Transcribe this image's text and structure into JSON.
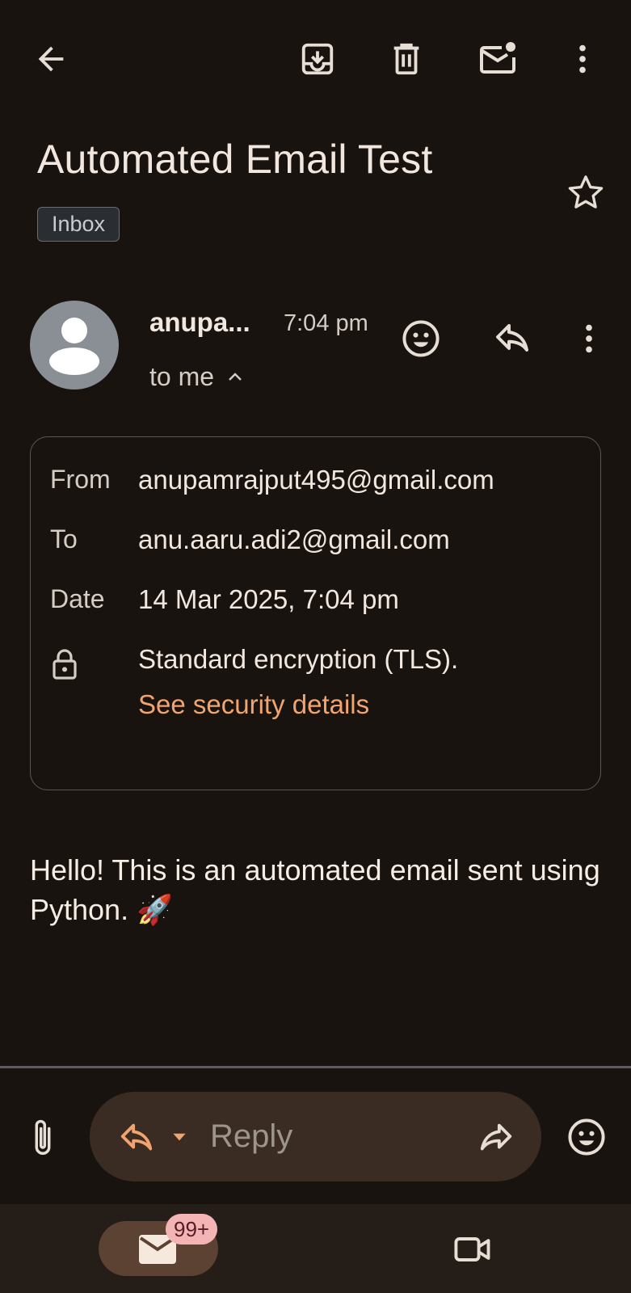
{
  "toolbar": {
    "back_icon": "arrow-left-icon",
    "archive_icon": "archive-icon",
    "delete_icon": "trash-icon",
    "unread_icon": "mark-unread-icon",
    "more_icon": "more-vert-icon"
  },
  "email": {
    "subject": "Automated Email Test",
    "label": "Inbox",
    "sender_name": "anupa...",
    "time": "7:04 pm",
    "recipient_summary": "to me",
    "details": {
      "from_label": "From",
      "from_value": "anupamrajput495@gmail.com",
      "to_label": "To",
      "to_value": "anu.aaru.adi2@gmail.com",
      "date_label": "Date",
      "date_value": "14 Mar 2025, 7:04 pm",
      "security_text": "Standard encryption (TLS).",
      "security_link": "See security details"
    },
    "body_text": "Hello! This is an automated email sent using Python. 🚀"
  },
  "reply_bar": {
    "placeholder": "Reply"
  },
  "bottom_nav": {
    "mail_badge": "99+",
    "mail_icon": "mail-icon",
    "meet_icon": "video-camera-icon"
  },
  "colors": {
    "background": "#19130f",
    "accent_link": "#f2a46e",
    "badge_bg": "#f4b3b5",
    "reply_box_bg": "#3a2c22",
    "mail_tab_bg": "#5b4232"
  }
}
